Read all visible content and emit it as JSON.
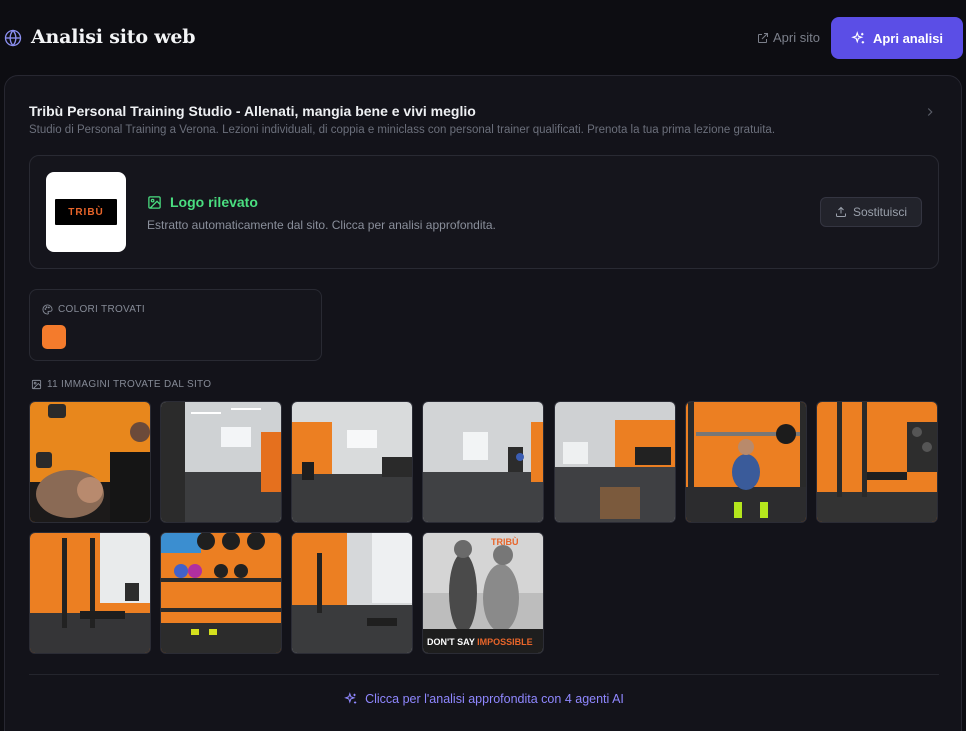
{
  "header": {
    "title": "Analisi sito web",
    "open_site": "Apri sito",
    "open_analysis": "Apri analisi"
  },
  "site": {
    "title": "Tribù Personal Training Studio - Allenati, mangia bene e vivi meglio",
    "description": "Studio di Personal Training a Verona. Lezioni individuali, di coppia e miniclass con personal trainer qualificati. Prenota la tua prima lezione gratuita."
  },
  "logo": {
    "mark_text": "TRIBÙ",
    "status": "Logo rilevato",
    "description": "Estratto automaticamente dal sito. Clicca per analisi approfondita.",
    "replace_label": "Sostituisci"
  },
  "colors": {
    "label": "COLORI TROVATI",
    "swatches": [
      "#f47b2c"
    ]
  },
  "images": {
    "label": "11 IMMAGINI TROVATE DAL SITO",
    "items": [
      {
        "name": "trainer-client-dumbbells"
      },
      {
        "name": "gym-room-racks"
      },
      {
        "name": "gym-room-rower"
      },
      {
        "name": "gym-room-wide"
      },
      {
        "name": "gym-room-box"
      },
      {
        "name": "bench-press"
      },
      {
        "name": "racks-orange-wall"
      },
      {
        "name": "rack-bench"
      },
      {
        "name": "kettlebell-shelf"
      },
      {
        "name": "gym-corner"
      },
      {
        "name": "bw-training-poster",
        "caption_a": "DON'T SAY ",
        "caption_b": "IMPOSSIBLE"
      }
    ]
  },
  "footer": {
    "deep_analysis": "Clicca per l'analisi approfondita con 4 agenti AI"
  },
  "accent_colors": {
    "primary": "#5b4ee6",
    "success": "#4ade80",
    "link": "#8f87ff"
  }
}
